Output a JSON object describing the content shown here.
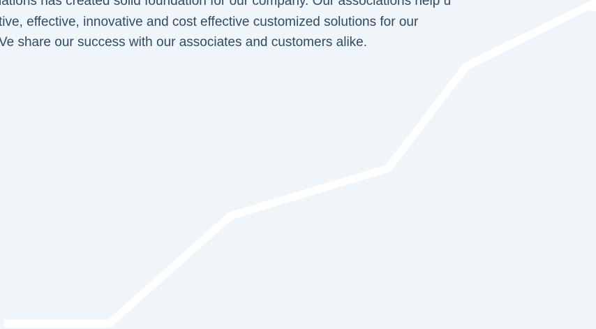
{
  "content": {
    "paragraph_lines": [
      "lations has created solid foundation for our company. Our associations help u",
      "tive, effective, innovative and cost effective customized solutions for our",
      "Ve share our success with our associates and customers alike."
    ]
  },
  "colors": {
    "background": "#f0f5fa",
    "text": "#2f4a64",
    "growth_line": "#ffffff"
  },
  "icons": {
    "growth_line": "growth-arrow-icon"
  }
}
